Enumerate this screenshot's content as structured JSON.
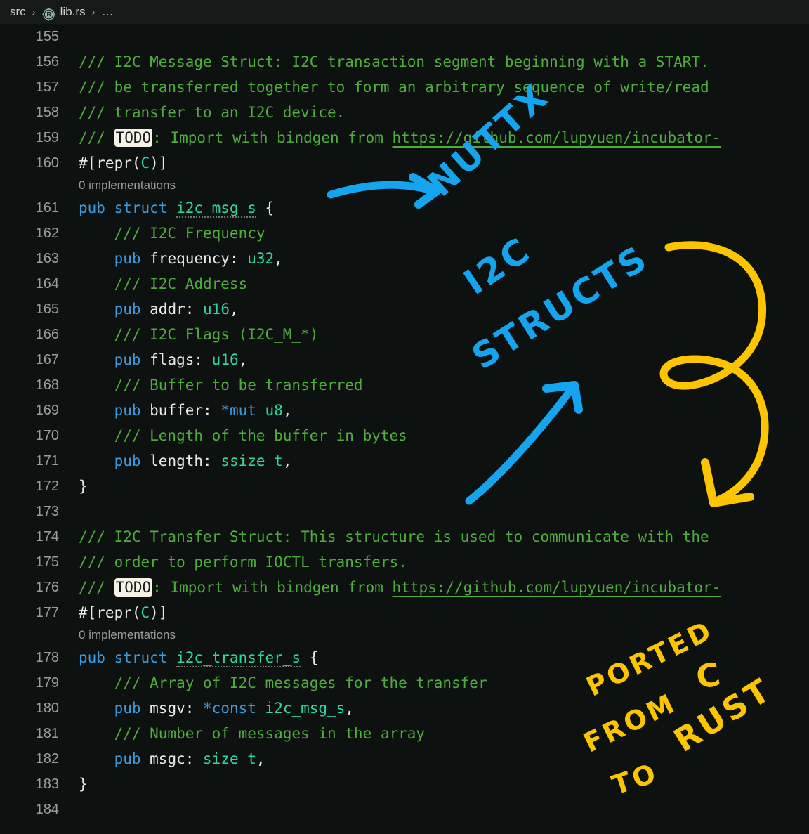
{
  "breadcrumb": {
    "items": [
      {
        "label": "src",
        "icon": null
      },
      {
        "label": "lib.rs",
        "icon": "rust-icon"
      },
      {
        "label": "…",
        "icon": null
      }
    ],
    "separator": "›",
    "src_label": "src",
    "file_label": "lib.rs",
    "ellipsis_label": "…"
  },
  "editor": {
    "language": "rust",
    "first_visible_line": 155,
    "last_visible_line": 184,
    "codelens_label": "0 implementations",
    "lines": [
      {
        "num": "155",
        "tokens": []
      },
      {
        "num": "156",
        "tokens": [
          {
            "t": "/// I2C Message Struct: I2C transaction segment beginning with a START.",
            "c": "c-comment"
          }
        ]
      },
      {
        "num": "157",
        "tokens": [
          {
            "t": "/// be transferred together to form an arbitrary sequence of write/read",
            "c": "c-comment"
          }
        ]
      },
      {
        "num": "158",
        "tokens": [
          {
            "t": "/// transfer to an I2C device.",
            "c": "c-comment"
          }
        ]
      },
      {
        "num": "159",
        "tokens": [
          {
            "t": "/// ",
            "c": "c-comment"
          },
          {
            "t": "TODO",
            "c": "todo"
          },
          {
            "t": ": Import with bindgen from ",
            "c": "c-comment"
          },
          {
            "t": "https://github.com/lupyuen/incubator-",
            "c": "c-link"
          }
        ]
      },
      {
        "num": "160",
        "tokens": [
          {
            "t": "#[repr(",
            "c": "c-plain"
          },
          {
            "t": "C",
            "c": "c-type"
          },
          {
            "t": ")]",
            "c": "c-plain"
          }
        ]
      },
      {
        "num": "161",
        "codelens": true,
        "tokens": [
          {
            "t": "pub struct ",
            "c": "c-kw"
          },
          {
            "t": "i2c_msg_s",
            "c": "c-struct"
          },
          {
            "t": " {",
            "c": "c-plain"
          }
        ]
      },
      {
        "num": "162",
        "tokens": [
          {
            "t": "    /// I2C Frequency",
            "c": "c-comment"
          }
        ]
      },
      {
        "num": "163",
        "tokens": [
          {
            "t": "    ",
            "c": "c-plain"
          },
          {
            "t": "pub",
            "c": "c-kw"
          },
          {
            "t": " frequency: ",
            "c": "c-plain"
          },
          {
            "t": "u32",
            "c": "c-type"
          },
          {
            "t": ",",
            "c": "c-plain"
          }
        ]
      },
      {
        "num": "164",
        "tokens": [
          {
            "t": "    /// I2C Address",
            "c": "c-comment"
          }
        ]
      },
      {
        "num": "165",
        "tokens": [
          {
            "t": "    ",
            "c": "c-plain"
          },
          {
            "t": "pub",
            "c": "c-kw"
          },
          {
            "t": " addr: ",
            "c": "c-plain"
          },
          {
            "t": "u16",
            "c": "c-type"
          },
          {
            "t": ",",
            "c": "c-plain"
          }
        ]
      },
      {
        "num": "166",
        "tokens": [
          {
            "t": "    /// I2C Flags (I2C_M_*)",
            "c": "c-comment"
          }
        ]
      },
      {
        "num": "167",
        "tokens": [
          {
            "t": "    ",
            "c": "c-plain"
          },
          {
            "t": "pub",
            "c": "c-kw"
          },
          {
            "t": " flags: ",
            "c": "c-plain"
          },
          {
            "t": "u16",
            "c": "c-type"
          },
          {
            "t": ",",
            "c": "c-plain"
          }
        ]
      },
      {
        "num": "168",
        "tokens": [
          {
            "t": "    /// Buffer to be transferred",
            "c": "c-comment"
          }
        ]
      },
      {
        "num": "169",
        "tokens": [
          {
            "t": "    ",
            "c": "c-plain"
          },
          {
            "t": "pub",
            "c": "c-kw"
          },
          {
            "t": " buffer: ",
            "c": "c-plain"
          },
          {
            "t": "*mut",
            "c": "c-kw"
          },
          {
            "t": " ",
            "c": "c-plain"
          },
          {
            "t": "u8",
            "c": "c-type"
          },
          {
            "t": ",",
            "c": "c-plain"
          }
        ]
      },
      {
        "num": "170",
        "tokens": [
          {
            "t": "    /// Length of the buffer in bytes",
            "c": "c-comment"
          }
        ]
      },
      {
        "num": "171",
        "tokens": [
          {
            "t": "    ",
            "c": "c-plain"
          },
          {
            "t": "pub",
            "c": "c-kw"
          },
          {
            "t": " length: ",
            "c": "c-plain"
          },
          {
            "t": "ssize_t",
            "c": "c-type"
          },
          {
            "t": ",",
            "c": "c-plain"
          }
        ]
      },
      {
        "num": "172",
        "tokens": [
          {
            "t": "}",
            "c": "c-plain"
          }
        ]
      },
      {
        "num": "173",
        "tokens": []
      },
      {
        "num": "174",
        "tokens": [
          {
            "t": "/// I2C Transfer Struct: This structure is used to communicate with the",
            "c": "c-comment"
          }
        ]
      },
      {
        "num": "175",
        "tokens": [
          {
            "t": "/// order to perform IOCTL transfers.",
            "c": "c-comment"
          }
        ]
      },
      {
        "num": "176",
        "tokens": [
          {
            "t": "/// ",
            "c": "c-comment"
          },
          {
            "t": "TODO",
            "c": "todo"
          },
          {
            "t": ": Import with bindgen from ",
            "c": "c-comment"
          },
          {
            "t": "https://github.com/lupyuen/incubator-",
            "c": "c-link"
          }
        ]
      },
      {
        "num": "177",
        "tokens": [
          {
            "t": "#[repr(",
            "c": "c-plain"
          },
          {
            "t": "C",
            "c": "c-type"
          },
          {
            "t": ")]",
            "c": "c-plain"
          }
        ]
      },
      {
        "num": "178",
        "codelens": true,
        "tokens": [
          {
            "t": "pub struct ",
            "c": "c-kw"
          },
          {
            "t": "i2c_transfer_s",
            "c": "c-struct"
          },
          {
            "t": " {",
            "c": "c-plain"
          }
        ]
      },
      {
        "num": "179",
        "tokens": [
          {
            "t": "    /// Array of I2C messages for the transfer",
            "c": "c-comment"
          }
        ]
      },
      {
        "num": "180",
        "tokens": [
          {
            "t": "    ",
            "c": "c-plain"
          },
          {
            "t": "pub",
            "c": "c-kw"
          },
          {
            "t": " msgv: ",
            "c": "c-plain"
          },
          {
            "t": "*const",
            "c": "c-kw"
          },
          {
            "t": " ",
            "c": "c-plain"
          },
          {
            "t": "i2c_msg_s",
            "c": "c-type"
          },
          {
            "t": ",",
            "c": "c-plain"
          }
        ]
      },
      {
        "num": "181",
        "tokens": [
          {
            "t": "    /// Number of messages in the array",
            "c": "c-comment"
          }
        ]
      },
      {
        "num": "182",
        "tokens": [
          {
            "t": "    ",
            "c": "c-plain"
          },
          {
            "t": "pub",
            "c": "c-kw"
          },
          {
            "t": " msgc: ",
            "c": "c-plain"
          },
          {
            "t": "size_t",
            "c": "c-type"
          },
          {
            "t": ",",
            "c": "c-plain"
          }
        ]
      },
      {
        "num": "183",
        "tokens": [
          {
            "t": "}",
            "c": "c-plain"
          }
        ]
      },
      {
        "num": "184",
        "tokens": []
      }
    ]
  },
  "annotations": {
    "blue_color": "#15a5ee",
    "yellow_color": "#fdc500",
    "blue_text_lines": [
      "NUTTX",
      "I2C",
      "STRUCTS"
    ],
    "nuttx_label": "NUTTX",
    "i2c_label": "I2C",
    "structs_label": "STRUCTS",
    "yellow_text_lines": [
      "PORTED",
      "C",
      "FROM",
      "RUST",
      "TO"
    ],
    "ported_label": "PORTED",
    "c_label": "C",
    "from_label": "FROM",
    "rust_label": "RUST",
    "to_label": "TO"
  },
  "colors": {
    "background": "#0d1110",
    "comment": "#4eae3d",
    "keyword": "#3c9ade",
    "type": "#2ed5a5",
    "plain": "#e8eae6",
    "linenumber": "#9b9f99",
    "breadcrumb_bg": "#151918",
    "annotation_blue": "#15a5ee",
    "annotation_yellow": "#fdc500"
  }
}
